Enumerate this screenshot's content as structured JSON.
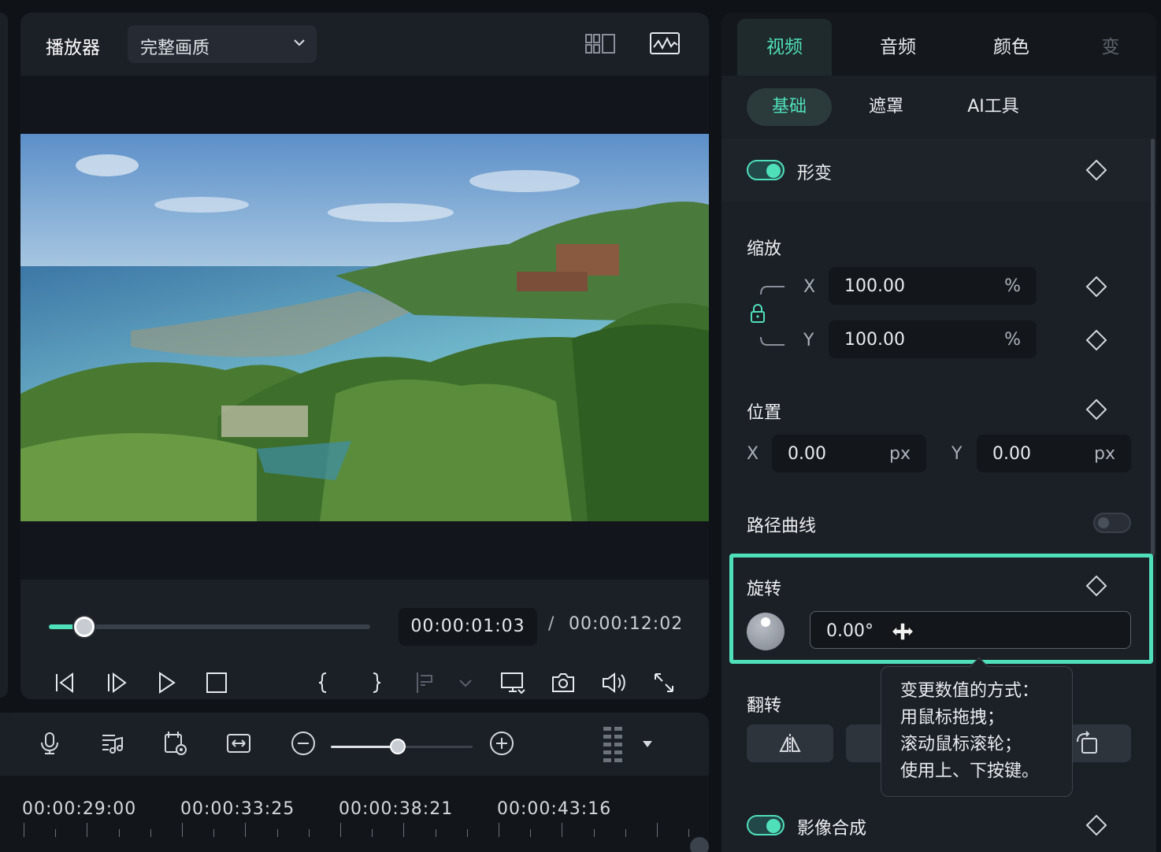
{
  "player": {
    "title": "播放器",
    "quality": "完整画质",
    "time_current": "00:00:01:03",
    "time_separator": "/",
    "time_total": "00:00:12:02",
    "progress": 0.11,
    "icons": [
      "grid-view-icon",
      "waveform-monitor-icon",
      "prev-frame-icon",
      "next-frame-icon",
      "play-icon",
      "stop-icon",
      "mark-in-icon",
      "mark-out-icon",
      "insert-icon",
      "display-icon",
      "snapshot-icon",
      "volume-icon",
      "fullscreen-icon"
    ]
  },
  "timeline": {
    "zoom_level": 0.47,
    "times": [
      "00:00:29:00",
      "00:00:33:25",
      "00:00:38:21",
      "00:00:43:16"
    ],
    "icons": [
      "microphone-icon",
      "music-list-icon",
      "clip-preview-icon",
      "fit-width-icon",
      "zoom-out-icon",
      "zoom-in-icon",
      "layout-icon",
      "dropdown-icon"
    ]
  },
  "panel": {
    "tabs": [
      "视频",
      "音频",
      "颜色",
      "变"
    ],
    "active_tab": "视频",
    "subtabs": [
      "基础",
      "遮罩",
      "AI工具"
    ],
    "active_subtab": "基础",
    "transform": {
      "label": "形变",
      "enabled": true
    },
    "scale": {
      "label": "缩放",
      "x_axis": "X",
      "y_axis": "Y",
      "x": "100.00",
      "y": "100.00",
      "unit": "%"
    },
    "position": {
      "label": "位置",
      "x_axis": "X",
      "y_axis": "Y",
      "x": "0.00",
      "y": "0.00",
      "unit": "px"
    },
    "path_curve": {
      "label": "路径曲线",
      "enabled": false
    },
    "rotation": {
      "label": "旋转",
      "value": "0.00°"
    },
    "flip": {
      "label": "翻转"
    },
    "compositing": {
      "label": "影像合成",
      "enabled": true
    }
  },
  "tooltip": {
    "line1": "变更数值的方式：",
    "line2": "用鼠标拖拽；",
    "line3": "滚动鼠标滚轮；",
    "line4": "使用上、下按键。"
  },
  "colors": {
    "accent": "#4fe0b9",
    "panel_bg": "#1b1f26",
    "app_bg": "#0f1317"
  }
}
